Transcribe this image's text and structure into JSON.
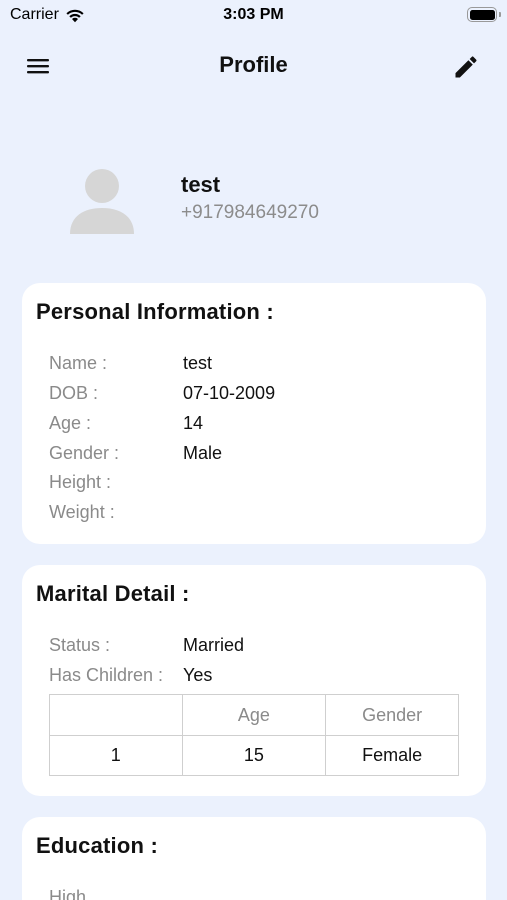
{
  "status_bar": {
    "carrier": "Carrier",
    "time": "3:03 PM",
    "icons": [
      "wifi-icon",
      "battery-icon"
    ]
  },
  "nav": {
    "title": "Profile",
    "left_icon": "hamburger-menu-icon",
    "right_icon": "pencil-edit-icon"
  },
  "profile": {
    "name": "test",
    "phone": "+917984649270",
    "avatar_icon": "person-avatar-icon"
  },
  "personal": {
    "title": "Personal Information :",
    "rows": [
      {
        "label": "Name :",
        "value": "test"
      },
      {
        "label": "DOB :",
        "value": "07-10-2009"
      },
      {
        "label": "Age :",
        "value": "14"
      },
      {
        "label": "Gender :",
        "value": "Male"
      },
      {
        "label": "Height :",
        "value": ""
      },
      {
        "label": "Weight :",
        "value": ""
      }
    ]
  },
  "marital": {
    "title": "Marital Detail :",
    "rows": [
      {
        "label": "Status :",
        "value": "Married"
      },
      {
        "label": "Has Children :",
        "value": "Yes"
      }
    ],
    "children_table": {
      "headers": [
        "",
        "Age",
        "Gender"
      ],
      "rows": [
        [
          "1",
          "15",
          "Female"
        ]
      ]
    }
  },
  "education": {
    "title": "Education :",
    "rows": [
      {
        "label": "High",
        "value": ""
      }
    ]
  },
  "colors": {
    "background": "#ebf1fd",
    "card": "#ffffff",
    "label": "#8a8a8a",
    "text": "#111111",
    "icon": "#111111"
  }
}
